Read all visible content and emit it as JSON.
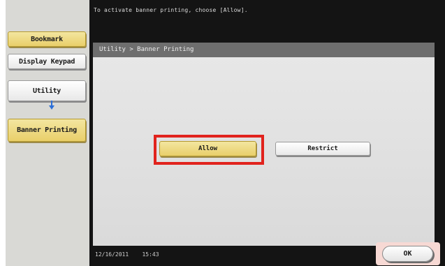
{
  "header": {
    "message": "To activate banner printing, choose [Allow]."
  },
  "sidebar": {
    "bookmark_label": "Bookmark",
    "display_keypad_label": "Display Keypad",
    "nav": [
      {
        "label": "Utility"
      },
      {
        "label": "Banner Printing"
      }
    ]
  },
  "breadcrumb": "Utility > Banner Printing",
  "options": {
    "allow_label": "Allow",
    "restrict_label": "Restrict",
    "selected": "Allow"
  },
  "footer": {
    "date": "12/16/2011",
    "time": "15:43",
    "ok_label": "OK"
  },
  "colors": {
    "highlight": "#e1231d",
    "selected_button": "#e9cf6a",
    "arrow": "#2c6fd8"
  }
}
